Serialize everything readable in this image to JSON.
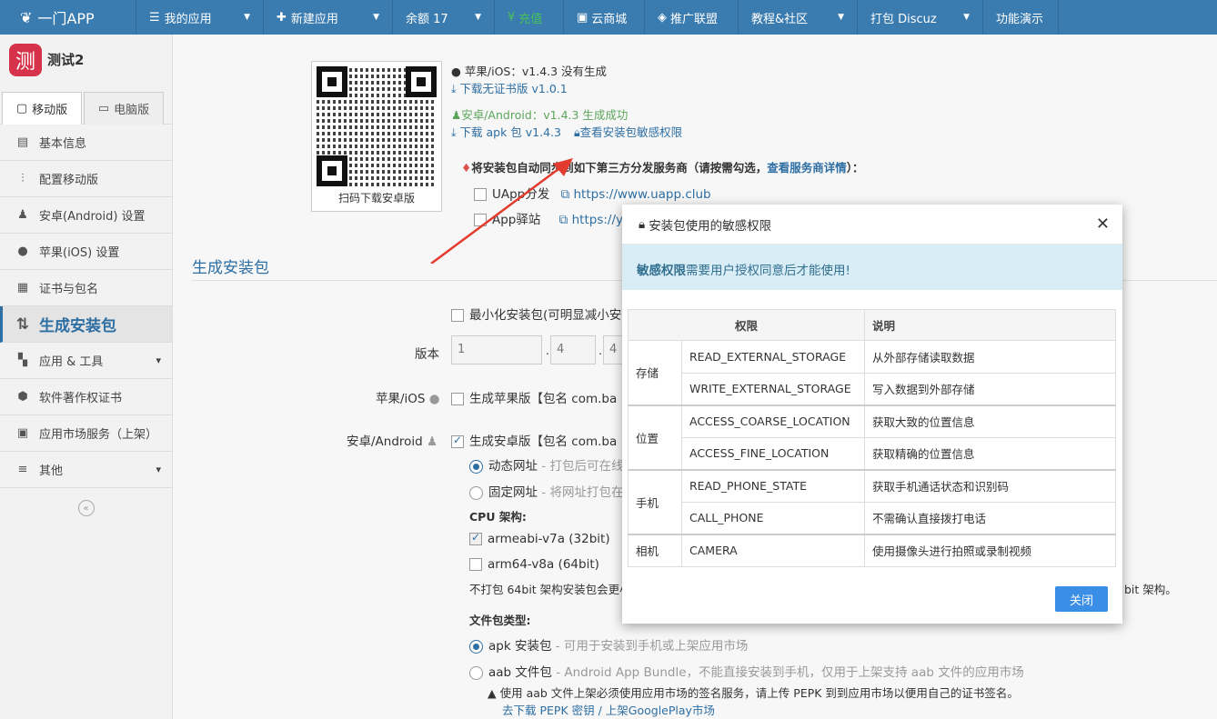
{
  "topnav": {
    "brand": "一门APP",
    "items": [
      {
        "label": "我的应用",
        "icon": "menu-icon",
        "dropdown": true
      },
      {
        "label": "新建应用",
        "icon": "plus-icon",
        "dropdown": true
      },
      {
        "label": "余额 17",
        "icon": "",
        "dropdown": true
      },
      {
        "label": "充值",
        "icon": "yen-icon",
        "dropdown": false
      },
      {
        "label": "云商城",
        "icon": "store-icon",
        "dropdown": false
      },
      {
        "label": "推广联盟",
        "icon": "diamond-icon",
        "dropdown": false
      },
      {
        "label": "教程&社区",
        "icon": "",
        "dropdown": true
      },
      {
        "label": "打包 Discuz",
        "icon": "",
        "dropdown": true
      },
      {
        "label": "功能演示",
        "icon": "",
        "dropdown": false
      }
    ]
  },
  "sidebar": {
    "project_logo": "测",
    "project_name": "测试2",
    "tabs": [
      "移动版",
      "电脑版"
    ],
    "items": [
      {
        "label": "基本信息",
        "icon": "info-icon"
      },
      {
        "label": "配置移动版",
        "icon": "sliders-icon"
      },
      {
        "label": "安卓(Android) 设置",
        "icon": "android-icon"
      },
      {
        "label": "苹果(iOS) 设置",
        "icon": "apple-icon"
      },
      {
        "label": "证书与包名",
        "icon": "certificate-icon"
      },
      {
        "label": "生成安装包",
        "icon": "sort-icon"
      },
      {
        "label": "应用 & 工具",
        "icon": "grid-icon"
      },
      {
        "label": "软件著作权证书",
        "icon": "badge-icon"
      },
      {
        "label": "应用市场服务（上架）",
        "icon": "market-icon"
      },
      {
        "label": "其他",
        "icon": "list-icon"
      }
    ]
  },
  "main": {
    "qr_caption": "扫码下载安卓版",
    "ios_status": "苹果/iOS：v1.4.3 没有生成",
    "ios_download": "下载无证书版 v1.0.1",
    "android_status": "安卓/Android：v1.4.3 生成成功",
    "apk_download": "下载 apk 包 v1.4.3",
    "view_permissions": "查看安装包敏感权限",
    "sync_note": "将安装包自动同步到如下第三方分发服务商（请按需勾选，",
    "sync_link": "查看服务商详情",
    "sync_end": "）：",
    "uapp_label": "UApp分发",
    "uapp_url": "https://www.uapp.club",
    "appstation_label": "App驿站",
    "appstation_url": "https://yi",
    "section_title": "生成安装包",
    "minimize_label": "最小化安装包(可明显减小安",
    "version_label": "版本",
    "version_parts": [
      "1",
      "4",
      "4"
    ],
    "ios_row_label": "苹果/iOS",
    "ios_gen": "生成苹果版【包名 com.ba",
    "android_row_label": "安卓/Android",
    "android_gen": "生成安卓版【包名 com.ba",
    "dynamic_url": "动态网址",
    "dynamic_url_hint": "- 打包后可在线",
    "fixed_url": "固定网址",
    "fixed_url_hint": "- 将网址打包在",
    "cpu_title": "CPU 架构:",
    "cpu1": "armeabi-v7a (32bit)",
    "cpu2": "arm64-v8a (64bit)",
    "cpu_note": "不打包 64bit 架构安装包会更小",
    "cpu_note_end": "bit 架构。",
    "filetype_title": "文件包类型:",
    "apk_label": "apk 安装包",
    "apk_hint": "- 可用于安装到手机或上架应用市场",
    "aab_label": "aab 文件包",
    "aab_hint": "- Android App Bundle，不能直接安装到手机，仅用于上架支持 aab 文件的应用市场",
    "aab_warning": "使用 aab 文件上架必须使用应用市场的签名服务，请上传 PEPK 到到应用市场以便用自己的证书签名。",
    "pepk_link": "去下载 PEPK 密钥 / 上架GooglePlay市场"
  },
  "modal": {
    "title": "安装包使用的敏感权限",
    "alert_bold": "敏感权限",
    "alert_text": "需要用户授权同意后才能使用!",
    "columns": [
      "权限",
      "说明"
    ],
    "groups": [
      {
        "name": "存储",
        "rows": [
          {
            "perm": "READ_EXTERNAL_STORAGE",
            "desc": "从外部存储读取数据"
          },
          {
            "perm": "WRITE_EXTERNAL_STORAGE",
            "desc": "写入数据到外部存储"
          }
        ]
      },
      {
        "name": "位置",
        "rows": [
          {
            "perm": "ACCESS_COARSE_LOCATION",
            "desc": "获取大致的位置信息"
          },
          {
            "perm": "ACCESS_FINE_LOCATION",
            "desc": "获取精确的位置信息"
          }
        ]
      },
      {
        "name": "手机",
        "rows": [
          {
            "perm": "READ_PHONE_STATE",
            "desc": "获取手机通话状态和识别码"
          },
          {
            "perm": "CALL_PHONE",
            "desc": "不需确认直接拨打电话"
          }
        ]
      },
      {
        "name": "相机",
        "rows": [
          {
            "perm": "CAMERA",
            "desc": "使用摄像头进行拍照或录制视频"
          }
        ]
      }
    ],
    "close_label": "关闭"
  },
  "colors": {
    "nav": "#3a7bb0",
    "accent": "#2d6ea3",
    "success": "#5ba55b",
    "button": "#3a8ee6",
    "alert_bg": "#d9edf7"
  }
}
